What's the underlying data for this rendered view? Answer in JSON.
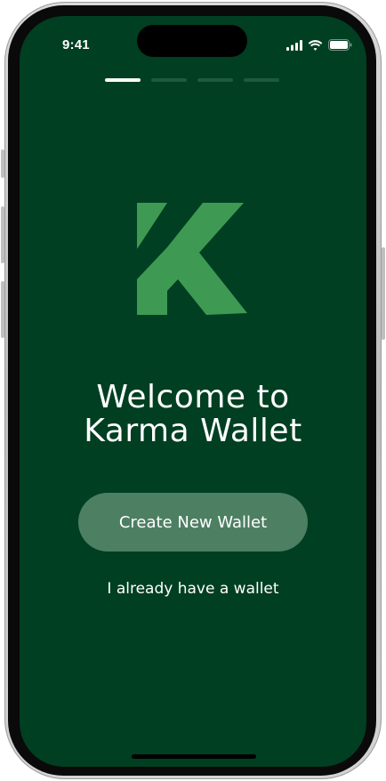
{
  "status_bar": {
    "time": "9:41",
    "icons": [
      "cellular-signal-icon",
      "wifi-icon",
      "battery-icon"
    ]
  },
  "onboarding": {
    "page_count": 4,
    "active_page": 1
  },
  "brand": {
    "logo_icon": "karma-k-logo-icon",
    "logo_color": "#3e9a53",
    "background_color": "#003f22"
  },
  "welcome": {
    "line1": "Welcome to",
    "line2": "Karma Wallet"
  },
  "actions": {
    "create_label": "Create New Wallet",
    "have_wallet_label": "I already have a wallet",
    "create_button_color": "#4d7f63"
  }
}
